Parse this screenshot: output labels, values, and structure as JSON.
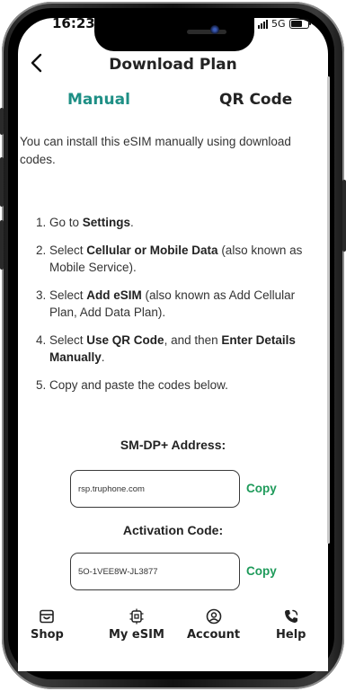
{
  "status_bar": {
    "time": "16:23",
    "network": "5G"
  },
  "header": {
    "title": "Download Plan"
  },
  "tabs": [
    {
      "label": "Manual",
      "active": true
    },
    {
      "label": "QR Code",
      "active": false
    }
  ],
  "intro": "You can install this eSIM manually using download codes.",
  "steps": {
    "s1": {
      "num": "1.",
      "a": "Go to ",
      "b1": "Settings",
      "c": "."
    },
    "s2": {
      "num": "2.",
      "a": "Select ",
      "b1": "Cellular or Mobile Data",
      "c": " (also known as Mobile Service)."
    },
    "s3": {
      "num": "3.",
      "a": "Select ",
      "b1": "Add eSIM",
      "c": " (also known as Add Cellular Plan, Add Data Plan)."
    },
    "s4": {
      "num": "4.",
      "a": "Select ",
      "b1": "Use QR Code",
      "c": ", and then ",
      "b2": "Enter Details Manually",
      "d": "."
    },
    "s5": {
      "num": "5.",
      "a": "Copy and paste the codes below."
    }
  },
  "smdp": {
    "label": "SM-DP+ Address:",
    "value": "rsp.truphone.com",
    "copy": "Copy"
  },
  "activation": {
    "label": "Activation Code:",
    "value": "5O-1VEE8W-JL3877",
    "copy": "Copy"
  },
  "nav": [
    {
      "label": "Shop",
      "icon": "shop-icon"
    },
    {
      "label": "My eSIM",
      "icon": "chip-icon"
    },
    {
      "label": "Account",
      "icon": "account-icon"
    },
    {
      "label": "Help",
      "icon": "phone-icon"
    }
  ],
  "colors": {
    "accent": "#1e8f85",
    "copy": "#1e9a5a",
    "text": "#333333"
  }
}
